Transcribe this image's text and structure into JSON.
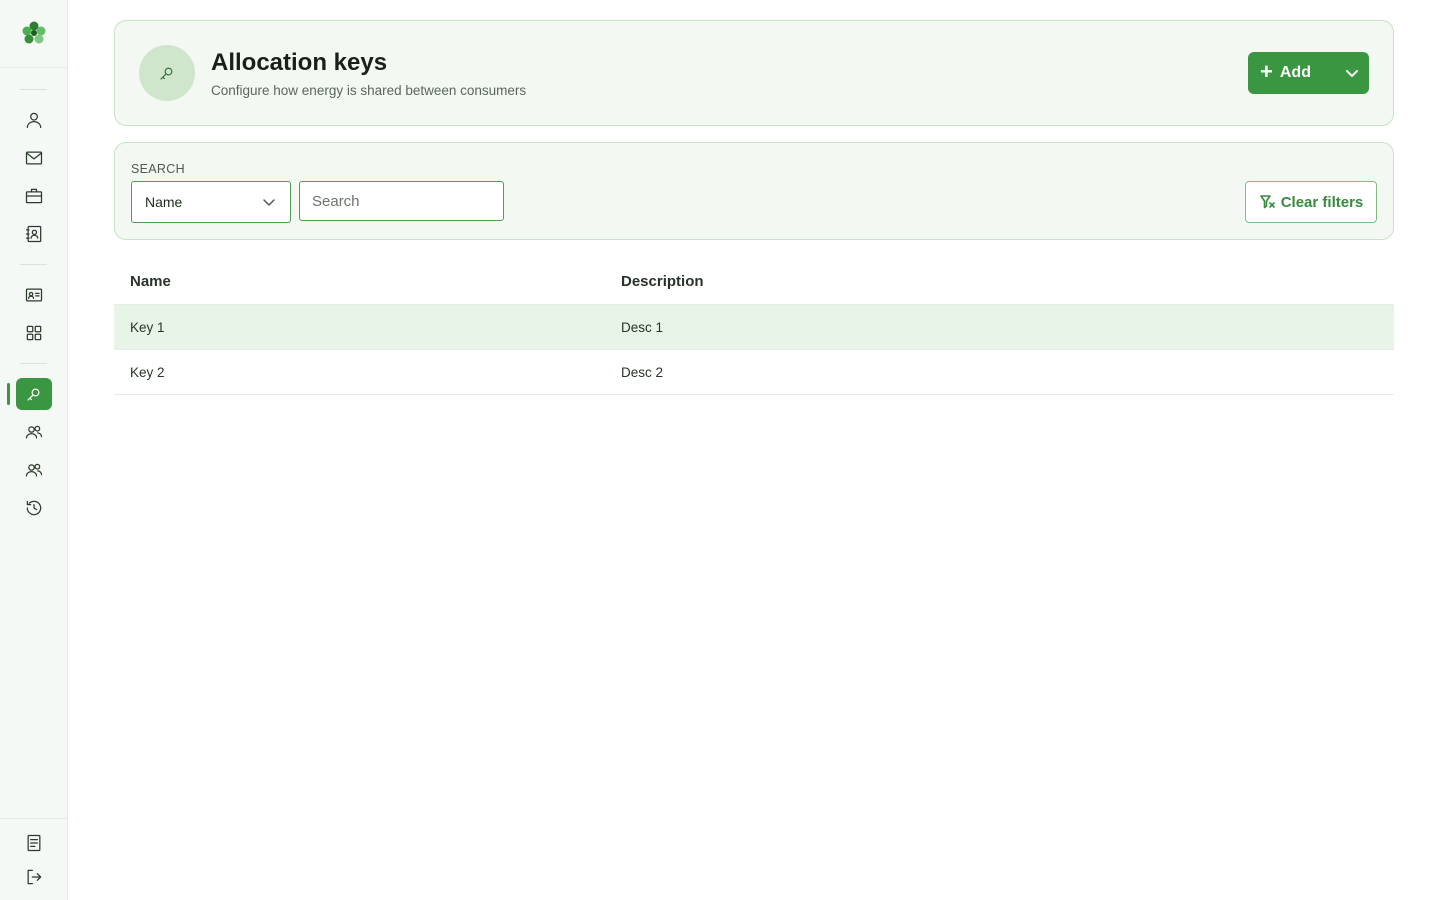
{
  "sidebar": {
    "logo": "clover-logo",
    "nav_top": [
      {
        "name": "user-icon"
      },
      {
        "name": "mail-icon"
      },
      {
        "name": "briefcase-icon"
      },
      {
        "name": "contact-book-icon"
      }
    ],
    "nav_middle": [
      {
        "name": "id-card-icon"
      },
      {
        "name": "grid-icon"
      }
    ],
    "nav_main": [
      {
        "name": "key-icon",
        "active": true
      },
      {
        "name": "group-icon"
      },
      {
        "name": "group-icon"
      },
      {
        "name": "history-icon"
      }
    ],
    "nav_bottom": [
      {
        "name": "document-icon"
      },
      {
        "name": "logout-icon"
      }
    ],
    "accent_color": "#3a9640"
  },
  "header": {
    "title": "Allocation keys",
    "subtitle": "Configure how energy is shared between consumers",
    "add_label": "Add"
  },
  "filters": {
    "section_label": "SEARCH",
    "field_select_value": "Name",
    "search_placeholder": "Search",
    "search_value": "",
    "clear_label": "Clear filters"
  },
  "table": {
    "columns": [
      "Name",
      "Description"
    ],
    "rows": [
      {
        "name": "Key 1",
        "description": "Desc 1",
        "selected": true
      },
      {
        "name": "Key 2",
        "description": "Desc 2",
        "selected": false
      }
    ]
  }
}
